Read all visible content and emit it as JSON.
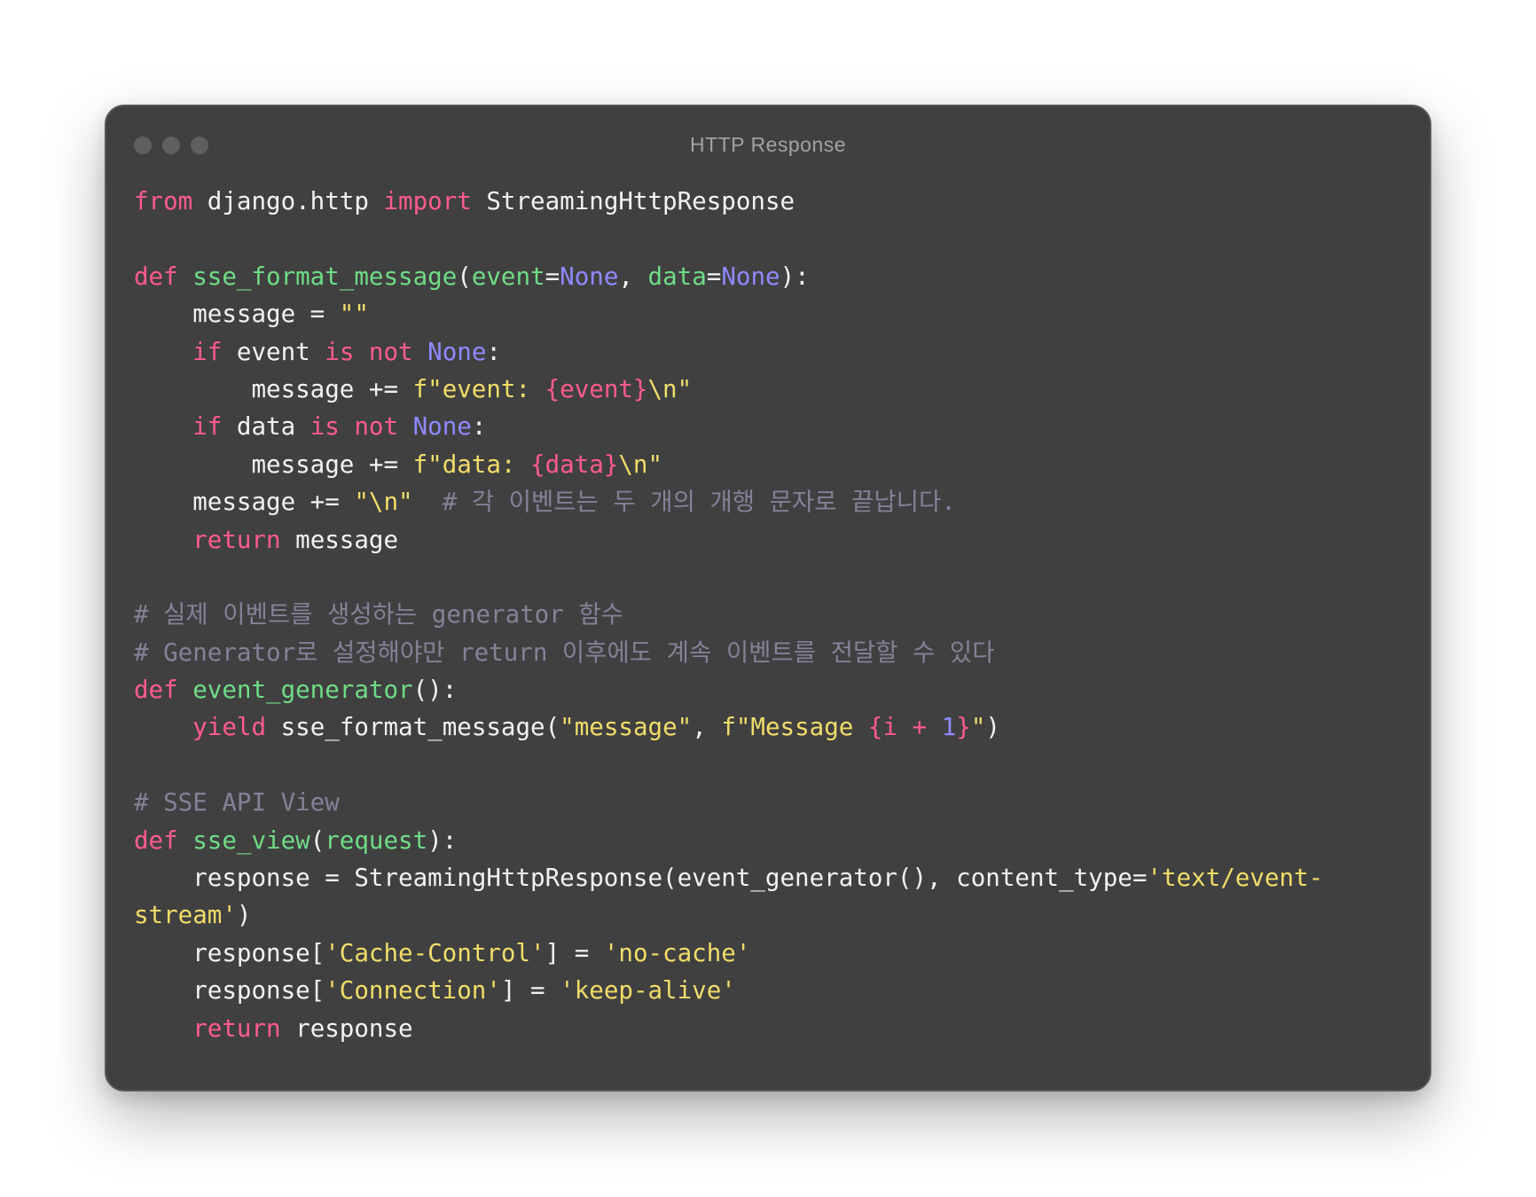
{
  "window": {
    "title": "HTTP Response"
  },
  "code": {
    "language": "python",
    "lines": [
      [
        {
          "t": "kw",
          "v": "from"
        },
        {
          "t": "id",
          "v": " django.http "
        },
        {
          "t": "kw",
          "v": "import"
        },
        {
          "t": "id",
          "v": " StreamingHttpResponse"
        }
      ],
      [],
      [
        {
          "t": "kw",
          "v": "def"
        },
        {
          "t": "id",
          "v": " "
        },
        {
          "t": "fn",
          "v": "sse_format_message"
        },
        {
          "t": "id",
          "v": "("
        },
        {
          "t": "param",
          "v": "event"
        },
        {
          "t": "id",
          "v": "="
        },
        {
          "t": "const",
          "v": "None"
        },
        {
          "t": "id",
          "v": ", "
        },
        {
          "t": "param",
          "v": "data"
        },
        {
          "t": "id",
          "v": "="
        },
        {
          "t": "const",
          "v": "None"
        },
        {
          "t": "id",
          "v": "):"
        }
      ],
      [
        {
          "t": "id",
          "v": "    message = "
        },
        {
          "t": "str",
          "v": "\"\""
        }
      ],
      [
        {
          "t": "id",
          "v": "    "
        },
        {
          "t": "kw",
          "v": "if"
        },
        {
          "t": "id",
          "v": " event "
        },
        {
          "t": "kw",
          "v": "is not"
        },
        {
          "t": "id",
          "v": " "
        },
        {
          "t": "const",
          "v": "None"
        },
        {
          "t": "id",
          "v": ":"
        }
      ],
      [
        {
          "t": "id",
          "v": "        message += "
        },
        {
          "t": "str",
          "v": "f\"event: "
        },
        {
          "t": "interp",
          "v": "{event}"
        },
        {
          "t": "str",
          "v": "\\n\""
        }
      ],
      [
        {
          "t": "id",
          "v": "    "
        },
        {
          "t": "kw",
          "v": "if"
        },
        {
          "t": "id",
          "v": " data "
        },
        {
          "t": "kw",
          "v": "is not"
        },
        {
          "t": "id",
          "v": " "
        },
        {
          "t": "const",
          "v": "None"
        },
        {
          "t": "id",
          "v": ":"
        }
      ],
      [
        {
          "t": "id",
          "v": "        message += "
        },
        {
          "t": "str",
          "v": "f\"data: "
        },
        {
          "t": "interp",
          "v": "{data}"
        },
        {
          "t": "str",
          "v": "\\n\""
        }
      ],
      [
        {
          "t": "id",
          "v": "    message += "
        },
        {
          "t": "str",
          "v": "\"\\n\""
        },
        {
          "t": "cmt",
          "v": "  # 각 이벤트는 두 개의 개행 문자로 끝납니다."
        }
      ],
      [
        {
          "t": "id",
          "v": "    "
        },
        {
          "t": "kw",
          "v": "return"
        },
        {
          "t": "id",
          "v": " message"
        }
      ],
      [],
      [
        {
          "t": "cmt",
          "v": "# 실제 이벤트를 생성하는 generator 함수"
        }
      ],
      [
        {
          "t": "cmt",
          "v": "# Generator로 설정해야만 return 이후에도 계속 이벤트를 전달할 수 있다"
        }
      ],
      [
        {
          "t": "kw",
          "v": "def"
        },
        {
          "t": "id",
          "v": " "
        },
        {
          "t": "fn",
          "v": "event_generator"
        },
        {
          "t": "id",
          "v": "():"
        }
      ],
      [
        {
          "t": "id",
          "v": "    "
        },
        {
          "t": "kw",
          "v": "yield"
        },
        {
          "t": "id",
          "v": " sse_format_message("
        },
        {
          "t": "str",
          "v": "\"message\""
        },
        {
          "t": "id",
          "v": ", "
        },
        {
          "t": "str",
          "v": "f\"Message "
        },
        {
          "t": "interp",
          "v": "{i + "
        },
        {
          "t": "const",
          "v": "1"
        },
        {
          "t": "interp",
          "v": "}"
        },
        {
          "t": "str",
          "v": "\""
        },
        {
          "t": "id",
          "v": ")"
        }
      ],
      [],
      [
        {
          "t": "cmt",
          "v": "# SSE API View"
        }
      ],
      [
        {
          "t": "kw",
          "v": "def"
        },
        {
          "t": "id",
          "v": " "
        },
        {
          "t": "fn",
          "v": "sse_view"
        },
        {
          "t": "id",
          "v": "("
        },
        {
          "t": "param",
          "v": "request"
        },
        {
          "t": "id",
          "v": "):"
        }
      ],
      [
        {
          "t": "id",
          "v": "    response = StreamingHttpResponse(event_generator(), content_type="
        },
        {
          "t": "str",
          "v": "'text/event-"
        }
      ],
      [
        {
          "t": "str",
          "v": "stream'"
        },
        {
          "t": "id",
          "v": ")"
        }
      ],
      [
        {
          "t": "id",
          "v": "    response["
        },
        {
          "t": "str",
          "v": "'Cache-Control'"
        },
        {
          "t": "id",
          "v": "] = "
        },
        {
          "t": "str",
          "v": "'no-cache'"
        }
      ],
      [
        {
          "t": "id",
          "v": "    response["
        },
        {
          "t": "str",
          "v": "'Connection'"
        },
        {
          "t": "id",
          "v": "] = "
        },
        {
          "t": "str",
          "v": "'keep-alive'"
        }
      ],
      [
        {
          "t": "id",
          "v": "    "
        },
        {
          "t": "kw",
          "v": "return"
        },
        {
          "t": "id",
          "v": " response"
        }
      ]
    ]
  }
}
